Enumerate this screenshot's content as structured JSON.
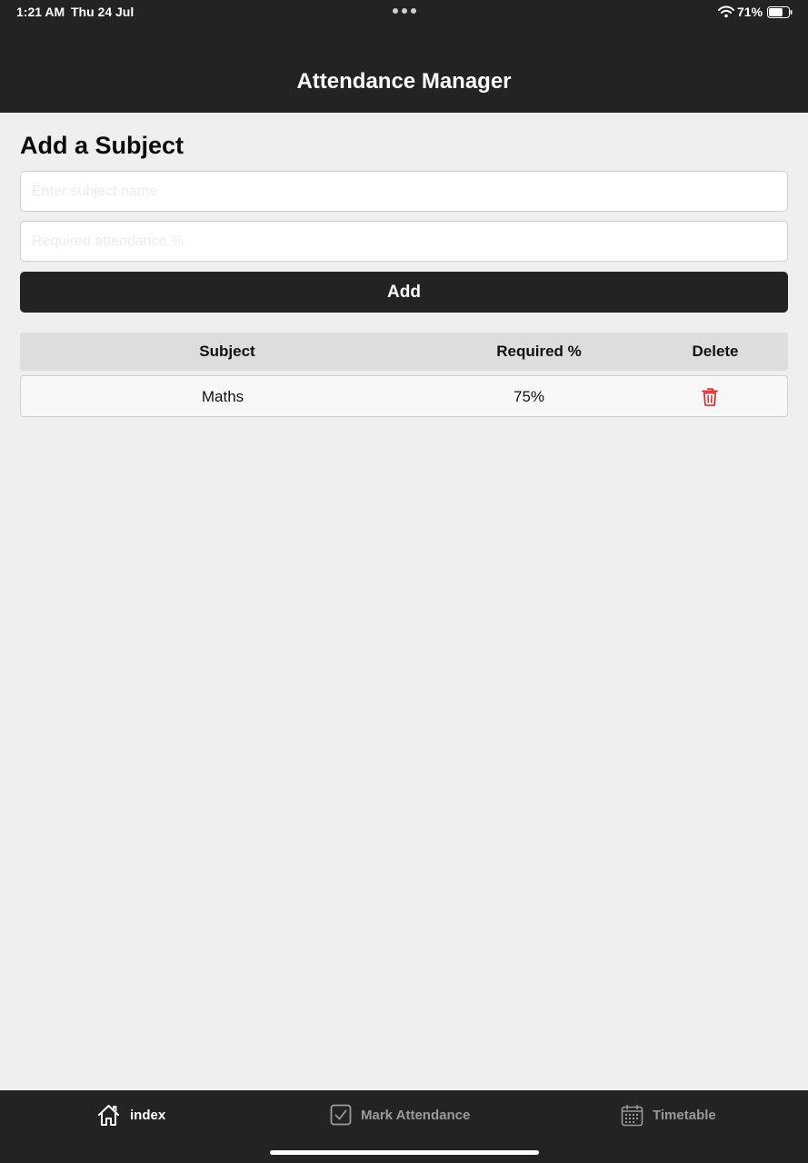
{
  "status_bar": {
    "time": "1:21 AM",
    "date": "Thu 24 Jul",
    "battery_percent": "71%",
    "battery_level": 0.71,
    "icons": [
      "more-dots-icon",
      "wifi-icon",
      "battery-icon"
    ]
  },
  "header": {
    "title": "Attendance Manager"
  },
  "form": {
    "section_title": "Add a Subject",
    "subject_input": {
      "value": "",
      "placeholder": "Enter subject name"
    },
    "attendance_input": {
      "value": "",
      "placeholder": "Required attendance %"
    },
    "add_label": "Add"
  },
  "table": {
    "headers": {
      "subject": "Subject",
      "required": "Required %",
      "delete": "Delete"
    },
    "rows": [
      {
        "subject": "Maths",
        "required": "75%",
        "delete_icon": "trash-icon"
      }
    ]
  },
  "tabbar": {
    "tabs": [
      {
        "label": "index",
        "icon": "home-icon",
        "active": true
      },
      {
        "label": "Mark Attendance",
        "icon": "checkbox-icon",
        "active": false
      },
      {
        "label": "Timetable",
        "icon": "calendar-icon",
        "active": false
      }
    ]
  },
  "colors": {
    "header_bg": "#232323",
    "page_bg": "#efefef",
    "button_bg": "#232323",
    "delete_icon": "#e02020",
    "tab_active": "#ffffff",
    "tab_inactive": "#9a9a9a"
  }
}
